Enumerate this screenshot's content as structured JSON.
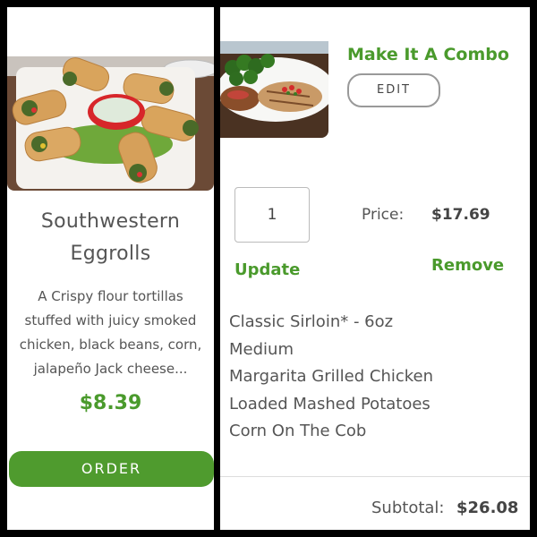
{
  "left_card": {
    "title_line1": "Southwestern",
    "title_line2": "Eggrolls",
    "description_lines": [
      "A Crispy flour tortillas",
      "stuffed with juicy smoked",
      "chicken, black beans, corn,",
      "jalapeño Jack cheese..."
    ],
    "price": "$8.39",
    "order_button": "ORDER",
    "accent_color": "#4f9b2e"
  },
  "cart_item": {
    "combo_title": "Make It A Combo",
    "edit_button": "EDIT",
    "quantity": "1",
    "price_label": "Price:",
    "price_value": "$17.69",
    "update_link": "Update",
    "remove_link": "Remove",
    "details": [
      "Classic Sirloin* - 6oz",
      "Medium",
      "Margarita Grilled Chicken",
      "Loaded Mashed Potatoes",
      "Corn On The Cob"
    ],
    "subtotal_label": "Subtotal:",
    "subtotal_value": "$26.08"
  }
}
